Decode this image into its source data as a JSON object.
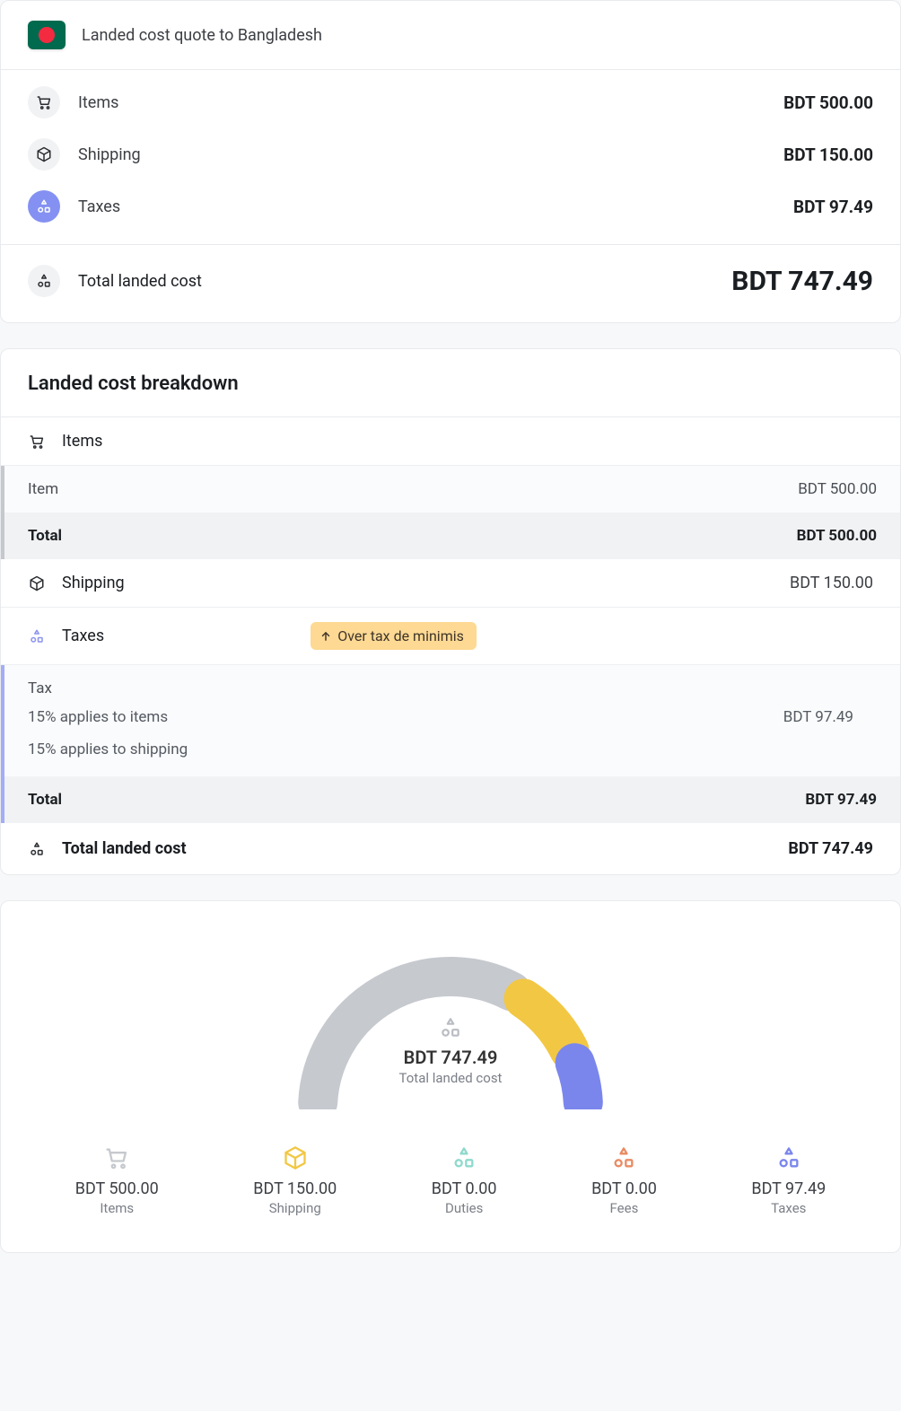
{
  "summary": {
    "title": "Landed cost quote to Bangladesh",
    "rows": [
      {
        "label": "Items",
        "value": "BDT 500.00"
      },
      {
        "label": "Shipping",
        "value": "BDT 150.00"
      },
      {
        "label": "Taxes",
        "value": "BDT 97.49"
      }
    ],
    "total_label": "Total landed cost",
    "total_value": "BDT 747.49"
  },
  "breakdown": {
    "title": "Landed cost breakdown",
    "items_label": "Items",
    "items_detail": [
      {
        "label": "Item",
        "value": "BDT 500.00"
      },
      {
        "label": "Total",
        "value": "BDT 500.00",
        "bold": true
      }
    ],
    "shipping_label": "Shipping",
    "shipping_value": "BDT 150.00",
    "taxes_label": "Taxes",
    "taxes_badge": "Over tax de minimis",
    "taxes_detail_head": "Tax",
    "taxes_lines": [
      {
        "label": "15% applies to items",
        "value": "BDT 97.49"
      },
      {
        "label": "15% applies to shipping",
        "value": ""
      }
    ],
    "taxes_total_label": "Total",
    "taxes_total_value": "BDT 97.49",
    "total_label": "Total landed cost",
    "total_value": "BDT 747.49"
  },
  "gauge": {
    "center_value": "BDT 747.49",
    "center_label": "Total landed cost",
    "legend": [
      {
        "label": "Items",
        "value": "BDT 500.00",
        "color": "#c6c9ce"
      },
      {
        "label": "Shipping",
        "value": "BDT 150.00",
        "color": "#f2c744"
      },
      {
        "label": "Duties",
        "value": "BDT 0.00",
        "color": "#8fd9cc"
      },
      {
        "label": "Fees",
        "value": "BDT 0.00",
        "color": "#e98b63"
      },
      {
        "label": "Taxes",
        "value": "BDT 97.49",
        "color": "#7a86ec"
      }
    ]
  },
  "chart_data": {
    "type": "pie",
    "title": "Total landed cost",
    "categories": [
      "Items",
      "Shipping",
      "Duties",
      "Fees",
      "Taxes"
    ],
    "values": [
      500.0,
      150.0,
      0.0,
      0.0,
      97.49
    ],
    "currency": "BDT",
    "total": 747.49,
    "colors": [
      "#c6c9ce",
      "#f2c744",
      "#8fd9cc",
      "#e98b63",
      "#7a86ec"
    ]
  }
}
